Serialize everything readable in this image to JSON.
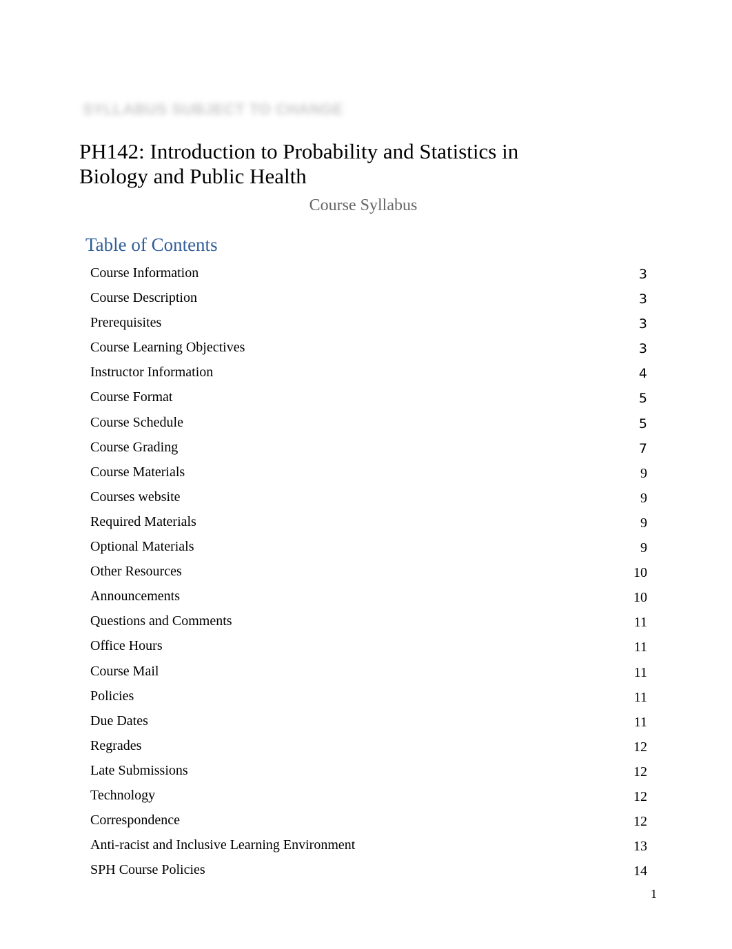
{
  "watermark": "SYLLABUS SUBJECT TO CHANGE",
  "title": "PH142: Introduction to Probability and Statistics in Biology and Public Health",
  "subtitle": "Course Syllabus",
  "toc": {
    "heading": "Table of Contents",
    "heading_color": "#2f5d99",
    "entries": [
      {
        "label": "Course Information",
        "page": "3"
      },
      {
        "label": "Course Description",
        "page": "3"
      },
      {
        "label": "Prerequisites",
        "page": "3"
      },
      {
        "label": "Course Learning Objectives",
        "page": "3"
      },
      {
        "label": "Instructor Information",
        "page": "4"
      },
      {
        "label": "Course Format",
        "page": "5"
      },
      {
        "label": "Course Schedule",
        "page": "5"
      },
      {
        "label": "Course Grading",
        "page": "7"
      },
      {
        "label": "Course Materials",
        "page": "9"
      },
      {
        "label": "Courses website",
        "page": "9"
      },
      {
        "label": "Required Materials",
        "page": "9"
      },
      {
        "label": "Optional Materials",
        "page": "9"
      },
      {
        "label": "Other Resources",
        "page": "10"
      },
      {
        "label": "Announcements",
        "page": "10"
      },
      {
        "label": "Questions and Comments",
        "page": "11"
      },
      {
        "label": "Office Hours",
        "page": "11"
      },
      {
        "label": "Course Mail",
        "page": "11"
      },
      {
        "label": "Policies",
        "page": "11"
      },
      {
        "label": "Due Dates",
        "page": "11"
      },
      {
        "label": "Regrades",
        "page": "12"
      },
      {
        "label": "Late Submissions",
        "page": "12"
      },
      {
        "label": "Technology",
        "page": "12"
      },
      {
        "label": "Correspondence",
        "page": "12"
      },
      {
        "label": "Anti-racist and Inclusive Learning Environment",
        "page": "13"
      },
      {
        "label": "SPH Course Policies",
        "page": "14"
      }
    ]
  },
  "page_number": "1"
}
